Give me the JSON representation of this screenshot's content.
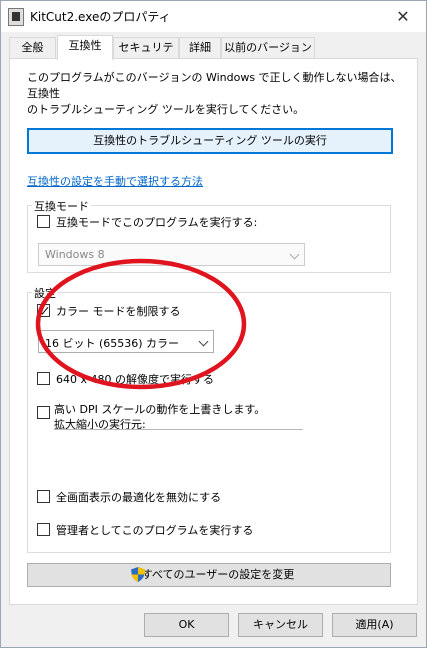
{
  "window": {
    "title": "KitCut2.exeのプロパティ",
    "close_glyph": "✕"
  },
  "tabs": [
    {
      "label": "全般"
    },
    {
      "label": "互換性",
      "active": true
    },
    {
      "label": "セキュリティ"
    },
    {
      "label": "詳細"
    },
    {
      "label": "以前のバージョン"
    }
  ],
  "description_line1": "このプログラムがこのバージョンの Windows で正しく動作しない場合は、互換性",
  "description_line2": "のトラブルシューティング ツールを実行してください。",
  "troubleshooter_button": "互換性のトラブルシューティング ツールの実行",
  "manual_link": "互換性の設定を手動で選択する方法",
  "compat_mode": {
    "group_label": "互換モード",
    "checkbox_label": "互換モードでこのプログラムを実行する:",
    "checked": false,
    "select_value": "Windows 8"
  },
  "settings": {
    "group_label": "設定",
    "reduced_color": {
      "label": "カラー モードを制限する",
      "checked": true
    },
    "color_select_value": "16 ビット (65536) カラー",
    "resolution": {
      "label": "640 x 480 の解像度で実行する",
      "checked": false
    },
    "dpi": {
      "label_line1": "高い DPI スケールの動作を上書きします。",
      "label_line2": "拡大縮小の実行元:",
      "checked": false
    },
    "fullscreen": {
      "label": "全画面表示の最適化を無効にする",
      "checked": false
    },
    "admin": {
      "label": "管理者としてこのプログラムを実行する",
      "checked": false
    }
  },
  "all_users_button": "すべてのユーザーの設定を変更",
  "footer": {
    "ok": "OK",
    "cancel": "キャンセル",
    "apply": "適用(A)"
  },
  "colors": {
    "annotation_circle": "#e0141e",
    "accent": "#0078d7",
    "link": "#0066cc"
  }
}
